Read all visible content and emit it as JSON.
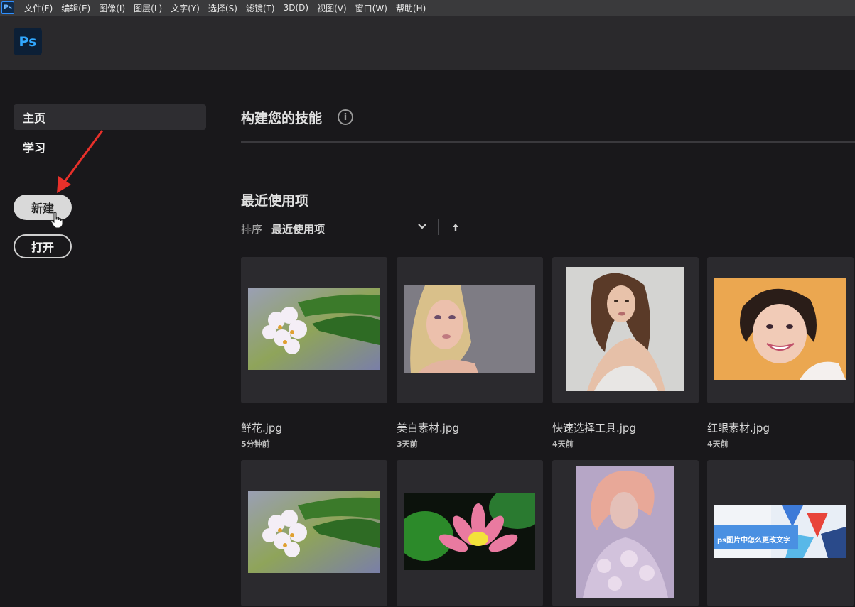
{
  "menubar": {
    "app_icon": "Ps",
    "items": [
      "文件(F)",
      "编辑(E)",
      "图像(I)",
      "图层(L)",
      "文字(Y)",
      "选择(S)",
      "滤镜(T)",
      "3D(D)",
      "视图(V)",
      "窗口(W)",
      "帮助(H)"
    ]
  },
  "header": {
    "logo": "Ps"
  },
  "sidebar": {
    "items": [
      {
        "label": "主页",
        "active": true
      },
      {
        "label": "学习",
        "active": false
      }
    ],
    "new_button": "新建",
    "open_button": "打开"
  },
  "main": {
    "skills_title": "构建您的技能",
    "info_icon": "i",
    "recent_title": "最近使用项",
    "sort": {
      "label": "排序",
      "value": "最近使用项"
    },
    "recent_files": [
      {
        "name": "鲜花.jpg",
        "time": "5分钟前",
        "thumb": "flowers"
      },
      {
        "name": "美白素材.jpg",
        "time": "3天前",
        "thumb": "blonde-woman"
      },
      {
        "name": "快速选择工具.jpg",
        "time": "4天前",
        "thumb": "brunette-woman"
      },
      {
        "name": "红眼素材.jpg",
        "time": "4天前",
        "thumb": "smiling-woman"
      },
      {
        "name": "",
        "time": "",
        "thumb": "flowers"
      },
      {
        "name": "",
        "time": "",
        "thumb": "lotus"
      },
      {
        "name": "",
        "time": "",
        "thumb": "pastel-portrait"
      },
      {
        "name": "",
        "time": "",
        "thumb": "banner",
        "banner_text": "ps图片中怎么更改文字"
      }
    ]
  },
  "colors": {
    "menubar_bg": "#3a3a3c",
    "header_bg": "#2a292c",
    "body_bg": "#19181b",
    "card_bg": "#2b2a2e",
    "ps_blue": "#31a8ff",
    "annotation_red": "#e8302a"
  }
}
